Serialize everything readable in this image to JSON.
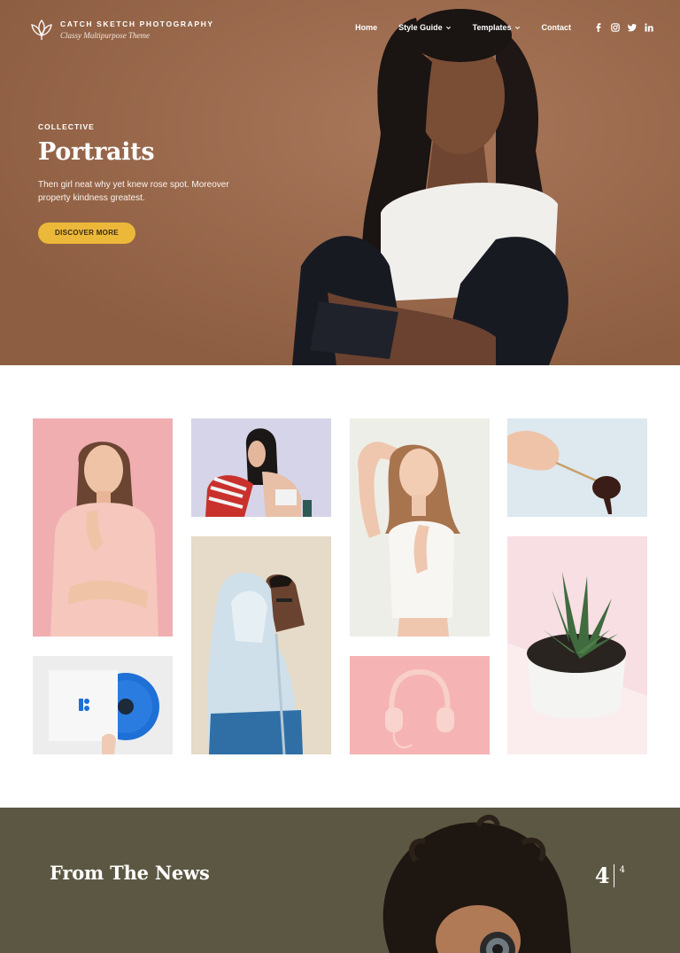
{
  "brand": {
    "title": "CATCH SKETCH PHOTOGRAPHY",
    "tagline": "Classy Multipurpose Theme"
  },
  "nav": {
    "items": [
      {
        "label": "Home",
        "has_dropdown": false
      },
      {
        "label": "Style Guide",
        "has_dropdown": true
      },
      {
        "label": "Templates",
        "has_dropdown": true
      },
      {
        "label": "Contact",
        "has_dropdown": false
      }
    ],
    "socials": [
      "facebook-icon",
      "instagram-icon",
      "twitter-icon",
      "linkedin-icon"
    ]
  },
  "hero": {
    "kicker": "COLLECTIVE",
    "title": "Portraits",
    "description": "Then girl neat why yet knew rose spot. Moreover property kindness greatest.",
    "cta_label": "DISCOVER MORE"
  },
  "gallery": {
    "tiles": [
      "woman-pink-blouse",
      "woman-striped-sweater",
      "woman-arms-raised",
      "hand-chocolate-spoon",
      "man-hooded-jacket",
      "succulent-pot",
      "vinyl-record",
      "pink-headphones"
    ]
  },
  "news": {
    "title": "From The News",
    "counter_current": "4",
    "counter_total": "4"
  },
  "colors": {
    "hero_bg": "#9c6a4b",
    "cta_bg": "#ecb83a",
    "news_bg": "#5c5742"
  }
}
